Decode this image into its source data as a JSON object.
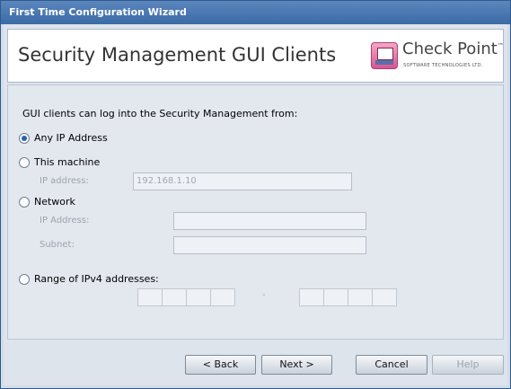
{
  "window": {
    "title": "First Time Configuration Wizard"
  },
  "header": {
    "title": "Security Management GUI Clients",
    "logo_text": "Check Point",
    "logo_trademark": "™",
    "logo_subtitle": "SOFTWARE TECHNOLOGIES LTD."
  },
  "body": {
    "intro": "GUI clients can log into the Security Management from:",
    "options": {
      "any_ip": {
        "label": "Any IP Address",
        "selected": true
      },
      "this_machine": {
        "label": "This machine",
        "selected": false,
        "ip_label": "IP address:",
        "ip_value": "192.168.1.10"
      },
      "network": {
        "label": "Network",
        "selected": false,
        "ip_label": "IP Address:",
        "ip_value": "",
        "subnet_label": "Subnet:",
        "subnet_value": ""
      },
      "range": {
        "label": "Range of IPv4 addresses:",
        "selected": false,
        "separator": "-"
      }
    }
  },
  "buttons": {
    "back": "< Back",
    "next": "Next >",
    "cancel": "Cancel",
    "help": "Help"
  }
}
